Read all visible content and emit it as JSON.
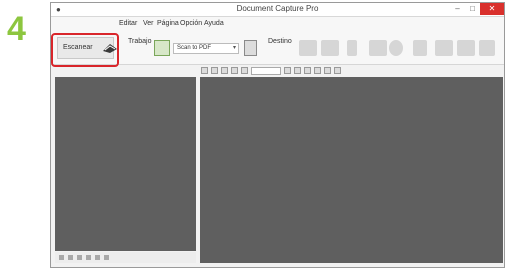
{
  "step": {
    "number": "4"
  },
  "window": {
    "title": "Document Capture Pro"
  },
  "menu": {
    "items": [
      "Editar",
      "Ver",
      "Página",
      "Opción",
      "Ayuda"
    ]
  },
  "toolbar": {
    "scan_label": "Escanear",
    "job_label": "Trabajo",
    "job_selected": "Scan to PDF",
    "destination_label": "Destino"
  },
  "icons": {
    "scan": "scan-icon",
    "job": "job-icon",
    "destinations": [
      "folder-icon",
      "mail-icon",
      "printer-icon",
      "web-icon",
      "globe-icon",
      "document-icon",
      "image-icon",
      "cloud-icon",
      "tools-icon"
    ]
  },
  "colors": {
    "step_number": "#8dc63f",
    "highlight": "#d9262b",
    "pane": "#5f5f5f",
    "close_button": "#d9302c"
  }
}
